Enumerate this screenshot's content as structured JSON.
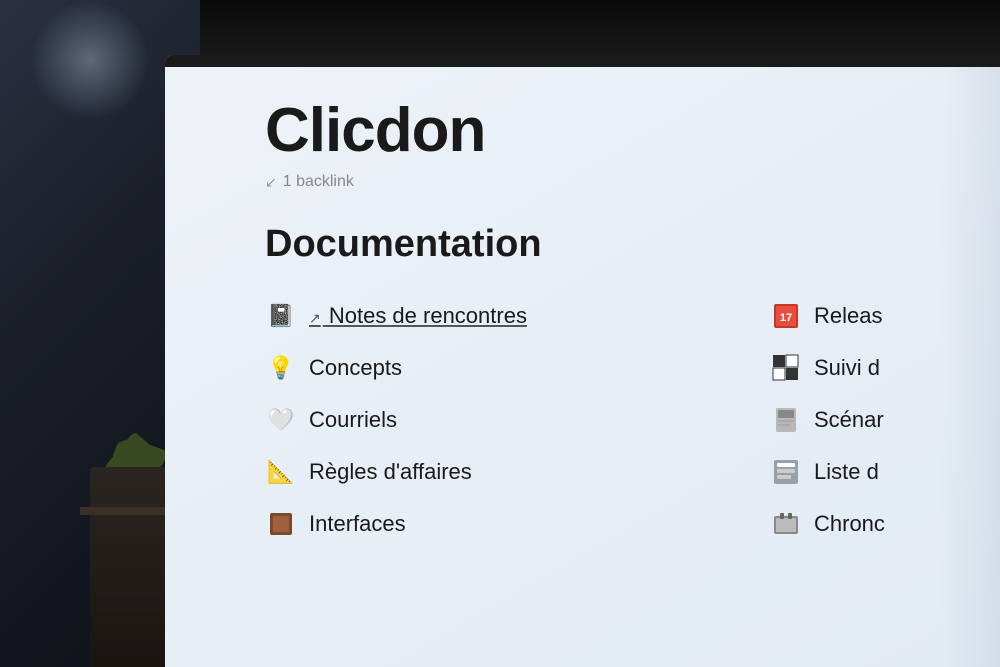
{
  "page": {
    "title": "Clicdon",
    "backlink_icon": "↙",
    "backlink_text": "1 backlink",
    "section_title": "Documentation",
    "left_items": [
      {
        "icon": "📓",
        "text": "Notes de rencontres",
        "linked": true,
        "link_arrow": "↗"
      },
      {
        "icon": "💡",
        "text": "Concepts",
        "linked": false,
        "link_arrow": ""
      },
      {
        "icon": "🤍",
        "text": "Courriels",
        "linked": false,
        "link_arrow": ""
      },
      {
        "icon": "📐",
        "text": "Règles d'affaires",
        "linked": false,
        "link_arrow": ""
      },
      {
        "icon": "🟫",
        "text": "Interfaces",
        "linked": false,
        "link_arrow": ""
      }
    ],
    "right_items": [
      {
        "icon": "📅",
        "text": "Releas",
        "partial": true
      },
      {
        "icon": "♟",
        "text": "Suivi d",
        "partial": true
      },
      {
        "icon": "🪑",
        "text": "Scénar",
        "partial": true
      },
      {
        "icon": "🗂",
        "text": "Liste d",
        "partial": true
      },
      {
        "icon": "📁",
        "text": "Chronc",
        "partial": true
      }
    ]
  }
}
